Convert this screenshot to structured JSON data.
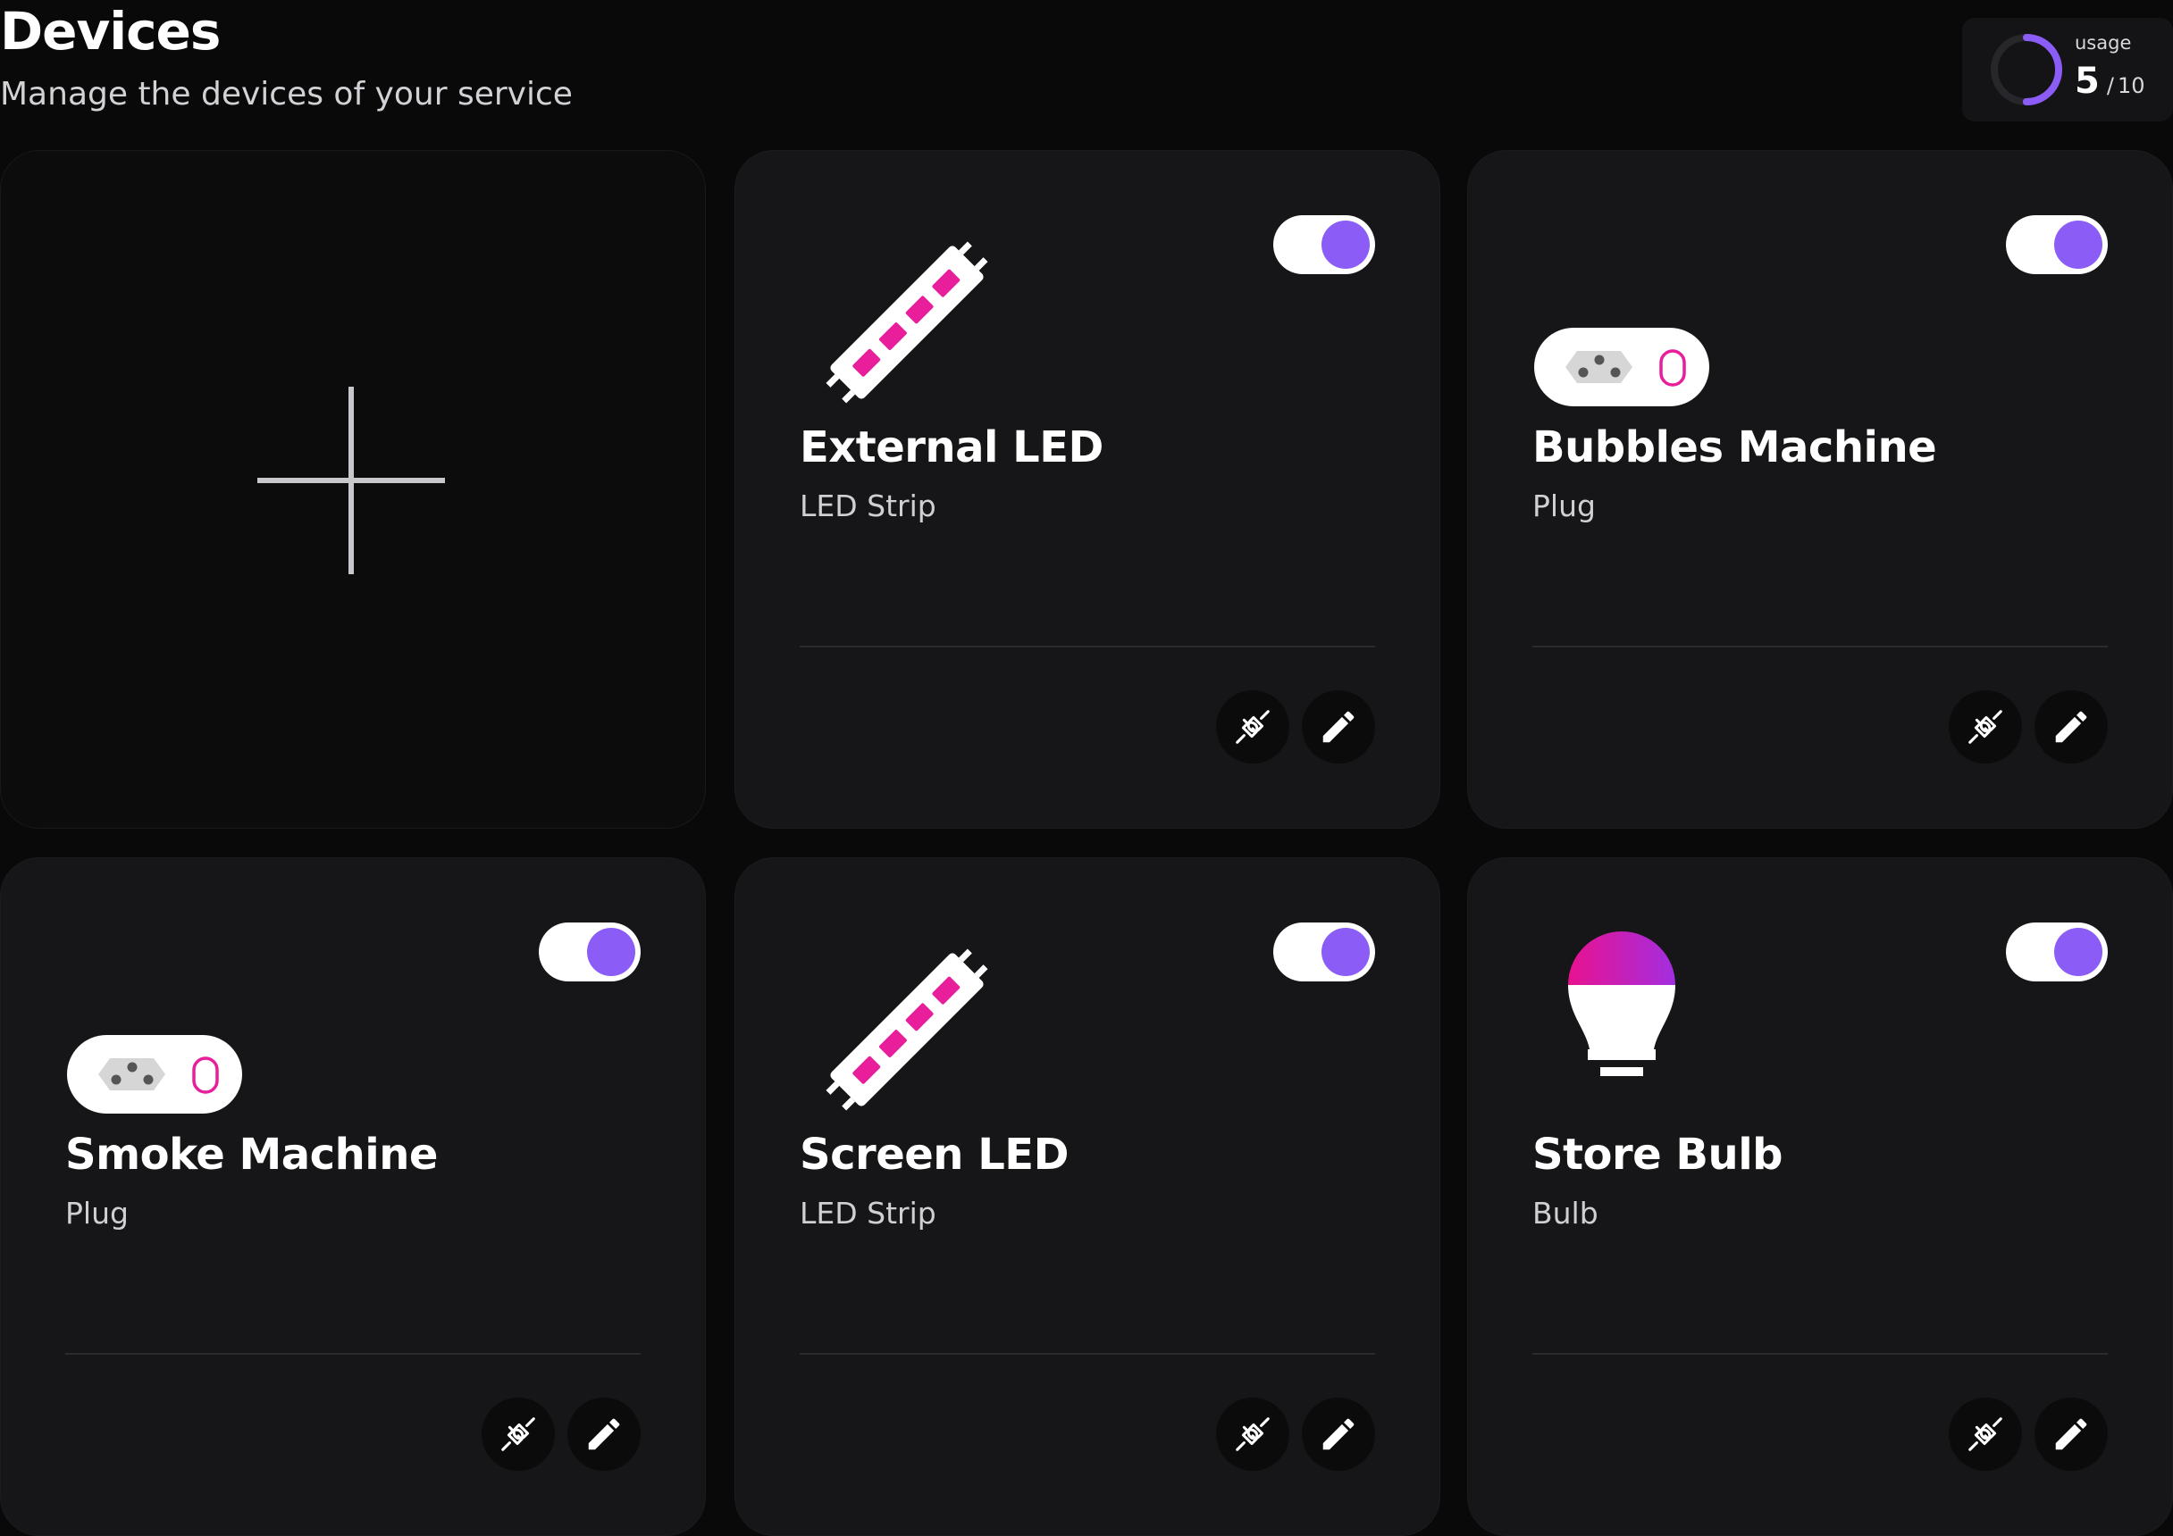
{
  "header": {
    "title": "Devices",
    "subtitle": "Manage the devices of your service"
  },
  "usage": {
    "label": "usage",
    "current": "5",
    "separator": "/",
    "max": "10",
    "fraction": 0.5,
    "ring_color": "#8b5cf6"
  },
  "add_card": {
    "icon": "plus-icon"
  },
  "devices": [
    {
      "name": "External LED",
      "type": "LED Strip",
      "icon": "led-strip-icon",
      "enabled": true
    },
    {
      "name": "Bubbles Machine",
      "type": "Plug",
      "icon": "plug-icon",
      "enabled": true
    },
    {
      "name": "Smoke Machine",
      "type": "Plug",
      "icon": "plug-icon",
      "enabled": true
    },
    {
      "name": "Screen LED",
      "type": "LED Strip",
      "icon": "led-strip-icon",
      "enabled": true
    },
    {
      "name": "Store Bulb",
      "type": "Bulb",
      "icon": "bulb-icon",
      "enabled": true
    }
  ],
  "actions": {
    "connect_icon": "plug-connection-icon",
    "edit_icon": "pencil-icon"
  },
  "colors": {
    "accent": "#8b5cf6",
    "magenta": "#e81e9a",
    "background": "#09090a",
    "card": "#161619"
  }
}
